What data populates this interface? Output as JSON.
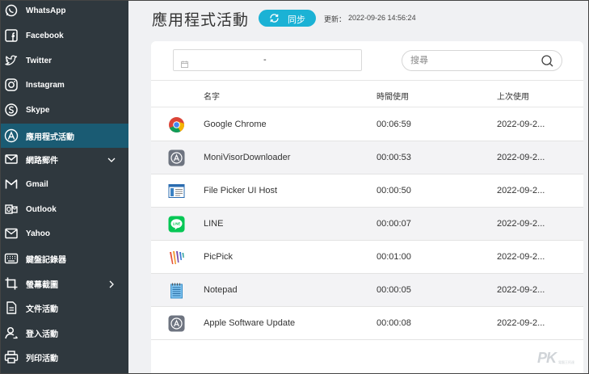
{
  "sidebar": {
    "items": [
      {
        "label": "WhatsApp",
        "icon": "whatsapp-icon"
      },
      {
        "label": "Facebook",
        "icon": "facebook-icon"
      },
      {
        "label": "Twitter",
        "icon": "twitter-icon"
      },
      {
        "label": "Instagram",
        "icon": "instagram-icon"
      },
      {
        "label": "Skype",
        "icon": "skype-icon"
      },
      {
        "label": "應用程式活動",
        "icon": "app-store-icon",
        "active": true
      },
      {
        "label": "網路郵件",
        "icon": "mail-icon",
        "chevron": "down"
      },
      {
        "label": "Gmail",
        "icon": "gmail-icon"
      },
      {
        "label": "Outlook",
        "icon": "outlook-icon"
      },
      {
        "label": "Yahoo",
        "icon": "yahoo-mail-icon"
      },
      {
        "label": "鍵盤記錄器",
        "icon": "keyboard-icon"
      },
      {
        "label": "螢幕截圖",
        "icon": "crop-icon",
        "chevron": "right"
      },
      {
        "label": "文件活動",
        "icon": "document-icon"
      },
      {
        "label": "登入活動",
        "icon": "user-login-icon"
      },
      {
        "label": "列印活動",
        "icon": "printer-icon"
      }
    ]
  },
  "header": {
    "title": "應用程式活動",
    "sync_label": "同步",
    "updated_prefix": "更新：",
    "updated_time": "2022-09-26 14:56:24"
  },
  "filters": {
    "date_separator": "-",
    "search_placeholder": "搜尋"
  },
  "table": {
    "columns": [
      "名字",
      "時間使用",
      "上次使用"
    ],
    "rows": [
      {
        "name": "Google Chrome",
        "duration": "00:06:59",
        "last_used": "2022-09-2...",
        "icon": "chrome-icon"
      },
      {
        "name": "MoniVisorDownloader",
        "duration": "00:00:53",
        "last_used": "2022-09-2...",
        "icon": "generic-app-icon"
      },
      {
        "name": "File Picker UI Host",
        "duration": "00:00:50",
        "last_used": "2022-09-2...",
        "icon": "file-picker-icon"
      },
      {
        "name": "LINE",
        "duration": "00:00:07",
        "last_used": "2022-09-2...",
        "icon": "line-icon"
      },
      {
        "name": "PicPick",
        "duration": "00:01:00",
        "last_used": "2022-09-2...",
        "icon": "picpick-icon"
      },
      {
        "name": "Notepad",
        "duration": "00:00:05",
        "last_used": "2022-09-2...",
        "icon": "notepad-icon"
      },
      {
        "name": "Apple Software Update",
        "duration": "00:00:08",
        "last_used": "2022-09-2...",
        "icon": "generic-app-icon"
      }
    ]
  },
  "watermark": {
    "text": "PK",
    "sub": "電腦王阿達"
  },
  "colors": {
    "sidebar_bg": "#2f383e",
    "sidebar_active": "#1a5b73",
    "accent": "#1bb2d5"
  }
}
